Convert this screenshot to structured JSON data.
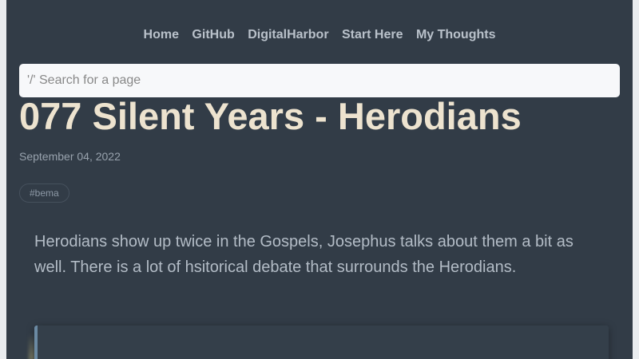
{
  "nav": {
    "items": [
      {
        "label": "Home"
      },
      {
        "label": "GitHub"
      },
      {
        "label": "DigitalHarbor"
      },
      {
        "label": "Start Here"
      },
      {
        "label": "My Thoughts"
      }
    ]
  },
  "search": {
    "placeholder": "'/' Search for a page"
  },
  "post": {
    "title": "077 Silent Years - Herodians",
    "date": "September 04, 2022",
    "tag": "#bema",
    "lead": "Herodians show up twice in the Gospels, Josephus talks about them a bit as well. There is a lot of hsitorical debate that surrounds the Herodians."
  },
  "colors": {
    "background": "#323c47",
    "title": "#ede3cf",
    "nav_text": "#b9c1ca",
    "search_bg": "#f7f8fa"
  }
}
